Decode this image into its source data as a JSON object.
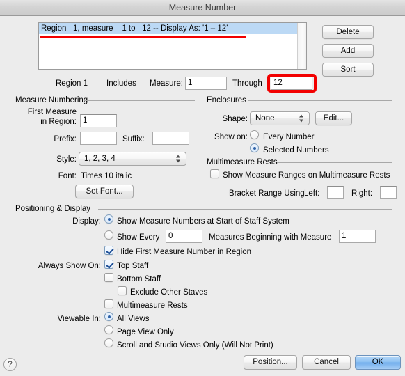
{
  "window": {
    "title": "Measure Number"
  },
  "regions_list": {
    "items": [
      "Region   1, measure    1 to   12 -- Display As: '1 – 12'"
    ],
    "selected_index": 0
  },
  "list_buttons": {
    "delete": "Delete",
    "add": "Add",
    "sort": "Sort"
  },
  "region_row": {
    "region_label": "Region 1",
    "includes_label": "Includes",
    "measure_label": "Measure:",
    "measure_value": "1",
    "through_label": "Through",
    "through_value": "12"
  },
  "measure_numbering": {
    "group_title": "Measure Numbering",
    "first_measure_label_line1": "First Measure",
    "first_measure_label_line2": "in Region:",
    "first_measure_value": "1",
    "prefix_label": "Prefix:",
    "prefix_value": "",
    "suffix_label": "Suffix:",
    "suffix_value": "",
    "style_label": "Style:",
    "style_value": "1, 2, 3, 4",
    "font_label": "Font:",
    "font_value": "Times 10 italic",
    "set_font_button": "Set Font..."
  },
  "enclosures": {
    "group_title": "Enclosures",
    "shape_label": "Shape:",
    "shape_value": "None",
    "edit_button": "Edit...",
    "show_on_label": "Show on:",
    "every_number": "Every Number",
    "selected_numbers": "Selected Numbers",
    "show_on_selected": "selected_numbers"
  },
  "multimeasure_rests": {
    "group_title": "Multimeasure Rests",
    "show_ranges_label": "Show Measure Ranges on Multimeasure Rests",
    "show_ranges_checked": false,
    "bracket_label": "Bracket Range Using",
    "left_label": "Left:",
    "left_value": "",
    "right_label": "Right:",
    "right_value": ""
  },
  "positioning": {
    "group_title": "Positioning & Display",
    "display_label": "Display:",
    "display_option_start_of_system": "Show Measure Numbers at Start of Staff System",
    "display_option_show_every": "Show Every",
    "show_every_value": "0",
    "measures_beginning_label": "Measures Beginning with Measure",
    "beginning_measure_value": "1",
    "display_selected": "start_of_system",
    "hide_first_label": "Hide First Measure Number in Region",
    "hide_first_checked": true,
    "always_show_label": "Always Show On:",
    "top_staff_label": "Top Staff",
    "top_staff_checked": true,
    "bottom_staff_label": "Bottom Staff",
    "bottom_staff_checked": false,
    "exclude_other_staves_label": "Exclude Other Staves",
    "exclude_other_staves_checked": false,
    "multimeasure_rests_label": "Multimeasure Rests",
    "multimeasure_rests_checked": false,
    "viewable_in_label": "Viewable In:",
    "all_views_label": "All Views",
    "page_view_only_label": "Page View Only",
    "scroll_studio_label": "Scroll and Studio Views Only (Will Not Print)",
    "viewable_selected": "all_views"
  },
  "footer": {
    "help": "?",
    "position_button": "Position...",
    "cancel_button": "Cancel",
    "ok_button": "OK"
  },
  "annotations": {
    "highlight_color": "#f20000"
  }
}
